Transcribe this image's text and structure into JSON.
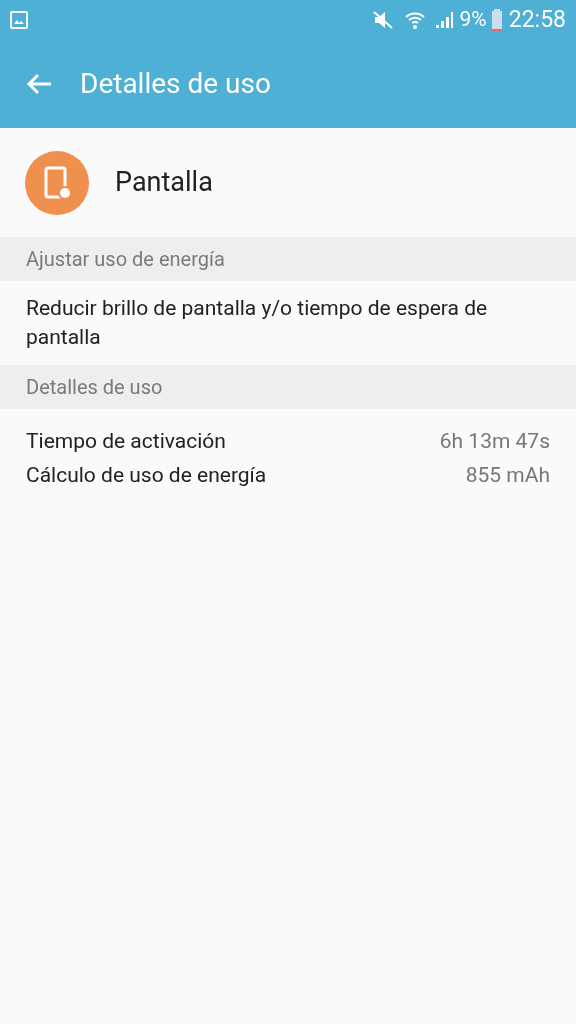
{
  "status_bar": {
    "battery_percent": "9%",
    "time": "22:58"
  },
  "app_bar": {
    "title": "Detalles de uso"
  },
  "app": {
    "name": "Pantalla"
  },
  "sections": [
    {
      "header": "Ajustar uso de energía",
      "items": [
        {
          "kind": "text",
          "text": "Reducir brillo de pantalla y/o tiempo de espera de pantalla"
        }
      ]
    },
    {
      "header": "Detalles de uso",
      "items": [
        {
          "kind": "pair",
          "label": "Tiempo de activación",
          "value": "6h 13m 47s"
        },
        {
          "kind": "pair",
          "label": "Cálculo de uso de energía",
          "value": "855 mAh"
        }
      ]
    }
  ]
}
